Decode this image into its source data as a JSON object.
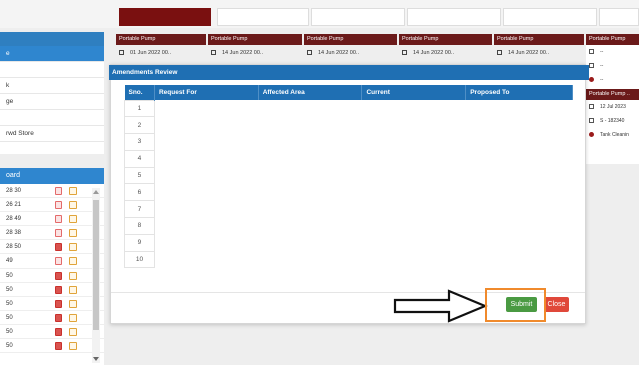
{
  "left_menu": {
    "items": [
      "e",
      "",
      "k",
      "ge",
      "",
      "rwd Store"
    ]
  },
  "board": {
    "title": "oard",
    "rows": [
      "28 30",
      "26 21",
      "28 49",
      "28 38",
      "28 50",
      "49",
      "50",
      "50",
      "50",
      "50",
      "50",
      "50"
    ]
  },
  "cards": [
    {
      "title": "Portable Pump",
      "date": "01 Jun 2022 00.."
    },
    {
      "title": "Portable Pump",
      "date": "14 Jun 2022 00.."
    },
    {
      "title": "Portable Pump",
      "date": "14 Jun 2022 00.."
    },
    {
      "title": "Portable Pump",
      "date": "14 Jun 2022 00.."
    },
    {
      "title": "Portable Pump",
      "date": "14 Jun 2022 00.."
    }
  ],
  "right_card": {
    "title": "Portable Pump",
    "rows": [
      "--",
      "--",
      "--"
    ],
    "title2": "Portable Pump ..",
    "rows2": [
      "12 Jul 2023",
      "S - 182340",
      "Tank Cleanin"
    ]
  },
  "modal": {
    "title": "Amendments Review",
    "columns": [
      "Sno.",
      "Request For",
      "Affected Area",
      "Current",
      "Proposed To"
    ],
    "row_numbers": [
      "1",
      "2",
      "3",
      "4",
      "5",
      "6",
      "7",
      "8",
      "9",
      "10"
    ],
    "submit_label": "Submit",
    "close_label": "Close"
  },
  "colors": {
    "header_blue": "#1f6fb3",
    "card_maroon": "#6b1a1a",
    "submit_green": "#4a9a42",
    "close_red": "#e0483a",
    "annotation_orange": "#f08a2c"
  }
}
